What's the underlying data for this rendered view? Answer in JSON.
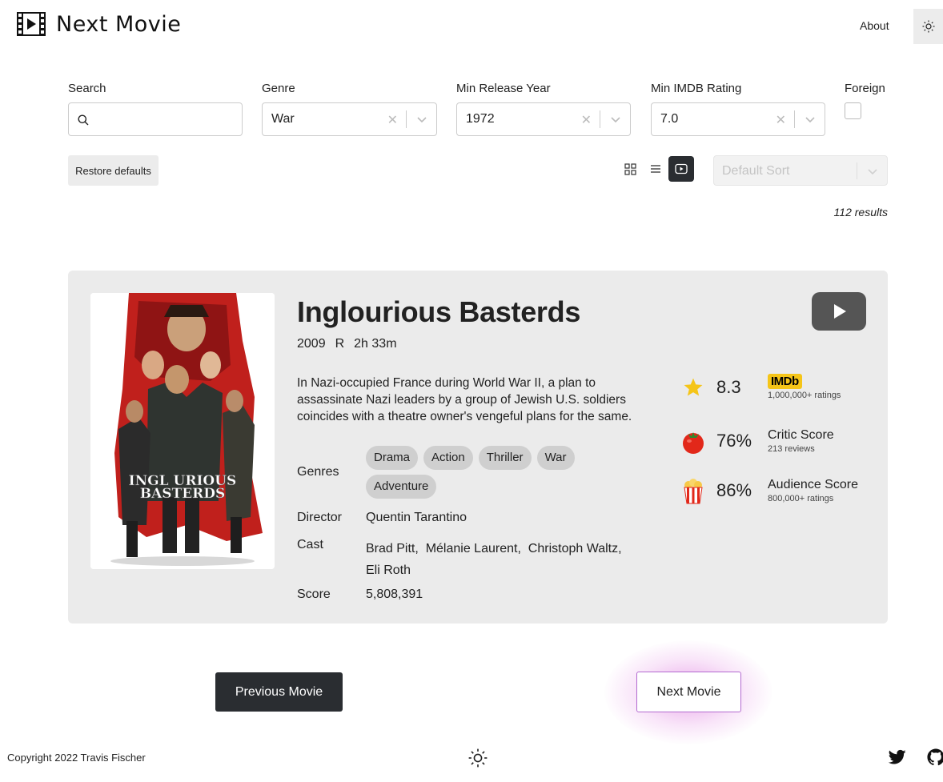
{
  "header": {
    "app_title": "Next Movie",
    "about_label": "About"
  },
  "filters": {
    "search": {
      "label": "Search",
      "value": ""
    },
    "genre": {
      "label": "Genre",
      "value": "War"
    },
    "min_release_year": {
      "label": "Min Release Year",
      "value": "1972"
    },
    "min_imdb_rating": {
      "label": "Min IMDB Rating",
      "value": "7.0"
    },
    "foreign": {
      "label": "Foreign",
      "checked": false
    }
  },
  "toolbar": {
    "restore_label": "Restore defaults",
    "active_view": "single",
    "sort_placeholder": "Default Sort",
    "results_text": "112 results"
  },
  "movie": {
    "title": "Inglourious Basterds",
    "year": "2009",
    "rated": "R",
    "runtime": "2h 33m",
    "plot": "In Nazi-occupied France during World War II, a plan to assassinate Nazi leaders by a group of Jewish U.S. soldiers coincides with a theatre owner's vengeful plans for the same.",
    "poster_title_line1": "INGL URIOUS",
    "poster_title_line2": "BASTERDS",
    "genres_label": "Genres",
    "genres": [
      "Drama",
      "Action",
      "Thriller",
      "War",
      "Adventure"
    ],
    "director_label": "Director",
    "director": "Quentin Tarantino",
    "cast_label": "Cast",
    "cast": [
      "Brad Pitt,",
      "Mélanie Laurent,",
      "Christoph Waltz,",
      "Eli Roth"
    ],
    "score_label": "Score",
    "score": "5,808,391",
    "ratings": {
      "imdb": {
        "value": "8.3",
        "badge": "IMDb",
        "sub": "1,000,000+ ratings"
      },
      "critic": {
        "value": "76%",
        "name": "Critic Score",
        "sub": "213 reviews"
      },
      "audience": {
        "value": "86%",
        "name": "Audience Score",
        "sub": "800,000+ ratings"
      }
    }
  },
  "navigation": {
    "previous_label": "Previous Movie",
    "next_label": "Next Movie"
  },
  "footer": {
    "copyright": "Copyright 2022 Travis Fischer"
  },
  "colors": {
    "dark_button": "#2a2d31",
    "card_background": "#ebebeb",
    "imdb_yellow": "#f5c518",
    "star": "#f5c518",
    "next_glow": "#d65ad6"
  }
}
